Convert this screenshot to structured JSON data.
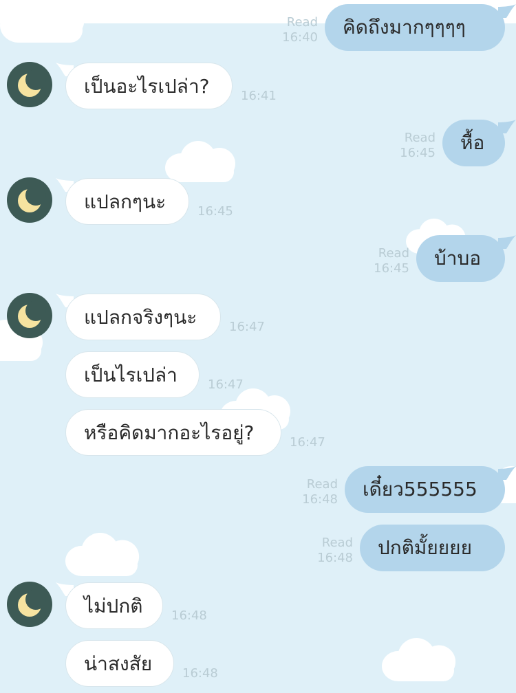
{
  "chat": {
    "messages": [
      {
        "id": 1,
        "dir": "out",
        "text": "คิดถึงมากๆๆๆๆ",
        "status": "Read",
        "time": "16:40"
      },
      {
        "id": 2,
        "dir": "in",
        "text": "เป็นอะไรเปล่า?",
        "time": "16:41"
      },
      {
        "id": 3,
        "dir": "out",
        "text": "หื้อ",
        "status": "Read",
        "time": "16:45"
      },
      {
        "id": 4,
        "dir": "in",
        "text": "แปลกๆนะ",
        "time": "16:45"
      },
      {
        "id": 5,
        "dir": "out",
        "text": "บ้าบอ",
        "status": "Read",
        "time": "16:45"
      },
      {
        "id": 6,
        "dir": "in",
        "text": "แปลกจริงๆนะ",
        "time": "16:47"
      },
      {
        "id": 7,
        "dir": "in",
        "text": "เป็นไรเปล่า",
        "time": "16:47"
      },
      {
        "id": 8,
        "dir": "in",
        "text": "หรือคิดมากอะไรอยู่?",
        "time": "16:47"
      },
      {
        "id": 9,
        "dir": "out",
        "text": "เดี๋ยว555555",
        "status": "Read",
        "time": "16:48"
      },
      {
        "id": 10,
        "dir": "out",
        "text": "ปกติมั้ยยยย",
        "status": "Read",
        "time": "16:48"
      },
      {
        "id": 11,
        "dir": "in",
        "text": "ไม่ปกติ",
        "time": "16:48"
      },
      {
        "id": 12,
        "dir": "in",
        "text": "น่าสงสัย",
        "time": "16:48"
      }
    ]
  },
  "contact": {
    "avatar_icon": "crescent-moon-icon",
    "avatar_bg": "#3d5a55",
    "avatar_moon": "#f6e3a0"
  },
  "theme": {
    "background": "#dff0f8",
    "incoming_bubble": "#ffffff",
    "outgoing_bubble": "#b3d5eb",
    "meta_text": "#b9ccd4"
  },
  "decor": {
    "cloud_icon": "cloud-icon"
  }
}
